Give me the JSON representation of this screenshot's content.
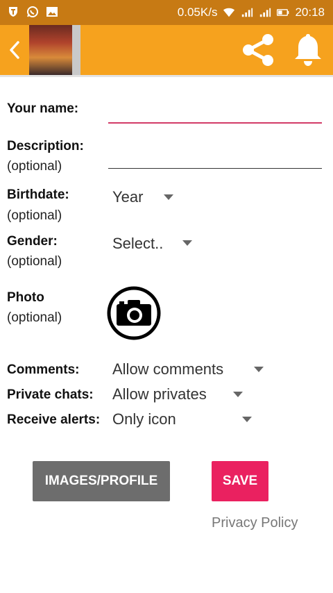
{
  "status_bar": {
    "network_speed": "0.05K/s",
    "time": "20:18",
    "icons_left": [
      "shield-icon",
      "whatsapp-icon",
      "image-icon"
    ],
    "icons_right": [
      "wifi-icon",
      "signal-icon",
      "signal-icon",
      "battery-icon"
    ]
  },
  "toolbar": {
    "back_icon": "chevron-left-icon",
    "share_icon": "share-icon",
    "bell_icon": "bell-icon"
  },
  "form": {
    "name": {
      "label": "Your name:",
      "value": ""
    },
    "description": {
      "label": "Description:",
      "optional": "(optional)",
      "value": ""
    },
    "birthdate": {
      "label": "Birthdate:",
      "optional": "(optional)",
      "value": "Year"
    },
    "gender": {
      "label": "Gender:",
      "optional": "(optional)",
      "value": "Select.."
    },
    "photo": {
      "label": "Photo",
      "optional": "(optional)",
      "icon": "camera-icon"
    },
    "comments": {
      "label": "Comments:",
      "value": "Allow comments"
    },
    "private_chats": {
      "label": "Private chats:",
      "value": "Allow privates"
    },
    "receive_alerts": {
      "label": "Receive alerts:",
      "value": "Only icon"
    }
  },
  "buttons": {
    "images_profile": "IMAGES/PROFILE",
    "save": "SAVE"
  },
  "links": {
    "privacy_policy": "Privacy Policy"
  },
  "colors": {
    "status_bar": "#c77a14",
    "toolbar": "#f6a21e",
    "name_underline": "#d23a67",
    "save_button": "#ea2160",
    "secondary_button": "#6d6d6d"
  }
}
